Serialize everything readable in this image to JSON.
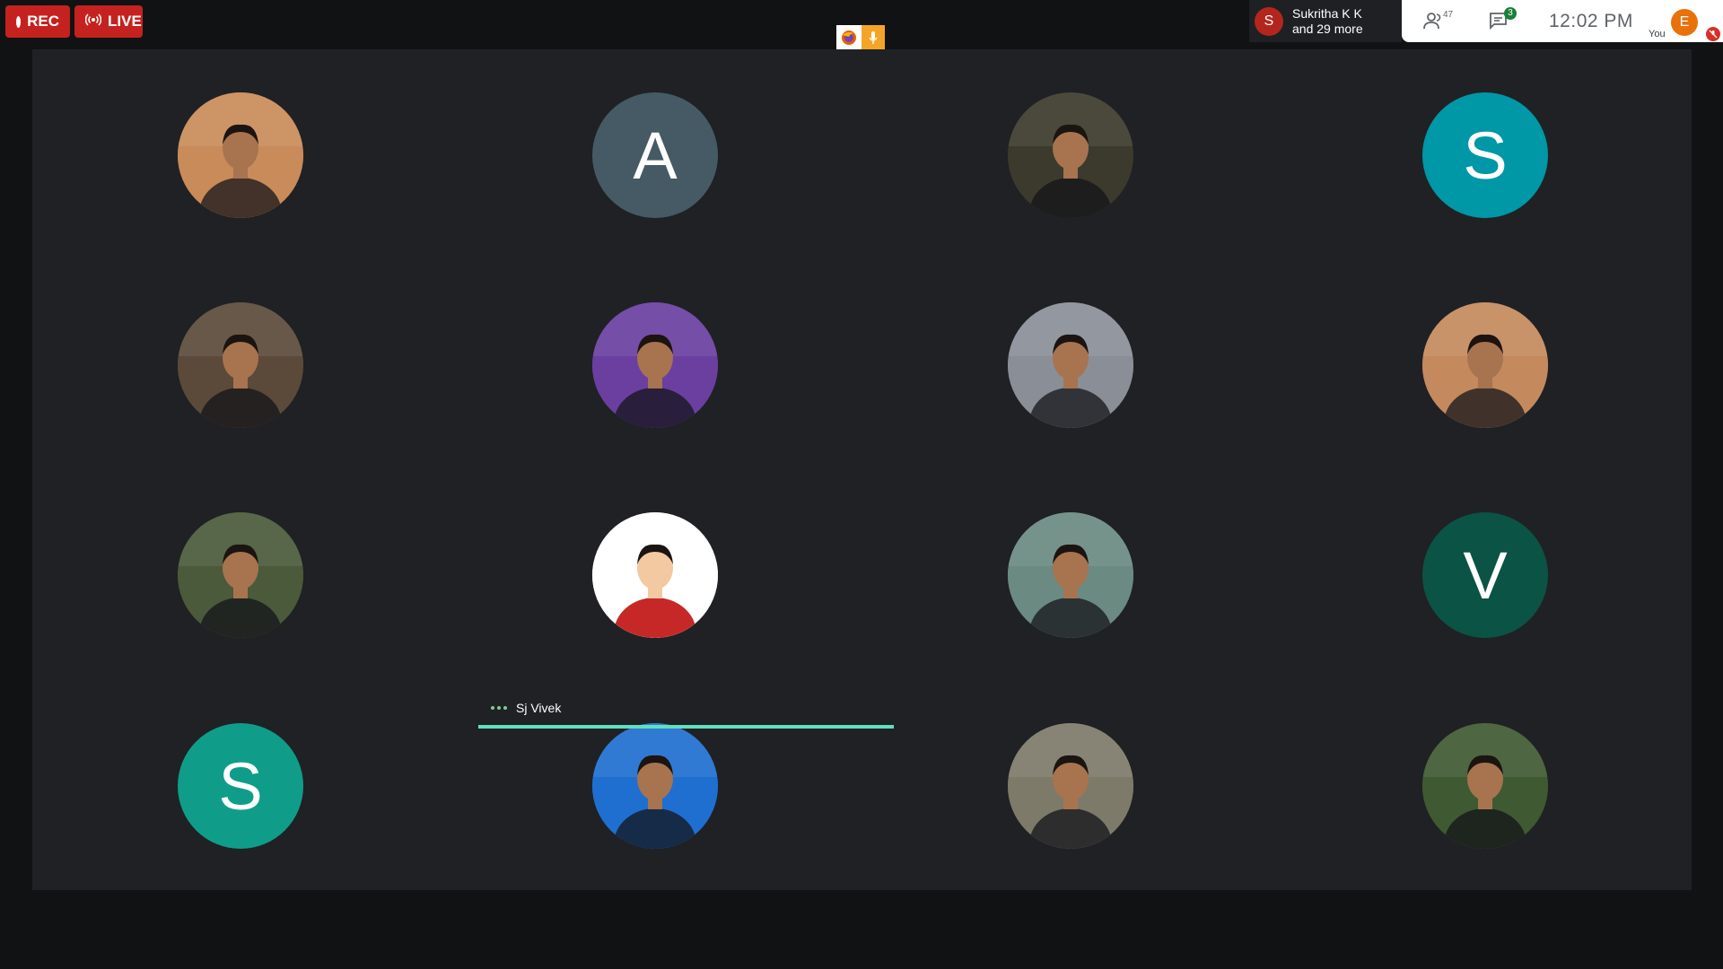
{
  "recording": {
    "rec_label": "REC",
    "live_label": "LIVE"
  },
  "speaker": {
    "initial": "S",
    "name": "Sukritha K K",
    "more": "and 29 more"
  },
  "toolbar": {
    "participants_count": "47",
    "chat_unread": "3",
    "time": "12:02  PM",
    "me_initial": "E",
    "me_label": "You"
  },
  "participants": [
    {
      "type": "photo",
      "icon": "presenter-photo",
      "bg": "#c98b5a"
    },
    {
      "type": "letter",
      "letter": "A",
      "bg": "#455a64"
    },
    {
      "type": "photo",
      "icon": "portrait-photo",
      "bg": "#3b3a2c"
    },
    {
      "type": "letter",
      "letter": "S",
      "bg": "#0097a7"
    },
    {
      "type": "photo",
      "icon": "person-photo",
      "bg": "#5b4a3a"
    },
    {
      "type": "photo",
      "icon": "person-hijab-photo",
      "bg": "#6a3fa0"
    },
    {
      "type": "photo",
      "icon": "person-sunglasses-photo",
      "bg": "#8a8f97"
    },
    {
      "type": "photo",
      "icon": "person-event-photo",
      "bg": "#c48a5d"
    },
    {
      "type": "photo",
      "icon": "person-hijab-photo",
      "bg": "#4a5a3a"
    },
    {
      "type": "photo",
      "icon": "cartoon-superhero-photo",
      "bg": "#ffffff"
    },
    {
      "type": "photo",
      "icon": "person-outdoor-photo",
      "bg": "#6b8a82"
    },
    {
      "type": "letter",
      "letter": "V",
      "bg": "#0b5345"
    },
    {
      "type": "letter",
      "letter": "S",
      "bg": "#0f9d8a"
    },
    {
      "type": "photo",
      "icon": "person-blue-bg-photo",
      "bg": "#1f6fd0"
    },
    {
      "type": "photo",
      "icon": "person-glasses-photo",
      "bg": "#7d7a6a"
    },
    {
      "type": "photo",
      "icon": "person-plants-photo",
      "bg": "#3f5a32"
    }
  ],
  "active_speaker": {
    "name": "Sj Vivek"
  }
}
